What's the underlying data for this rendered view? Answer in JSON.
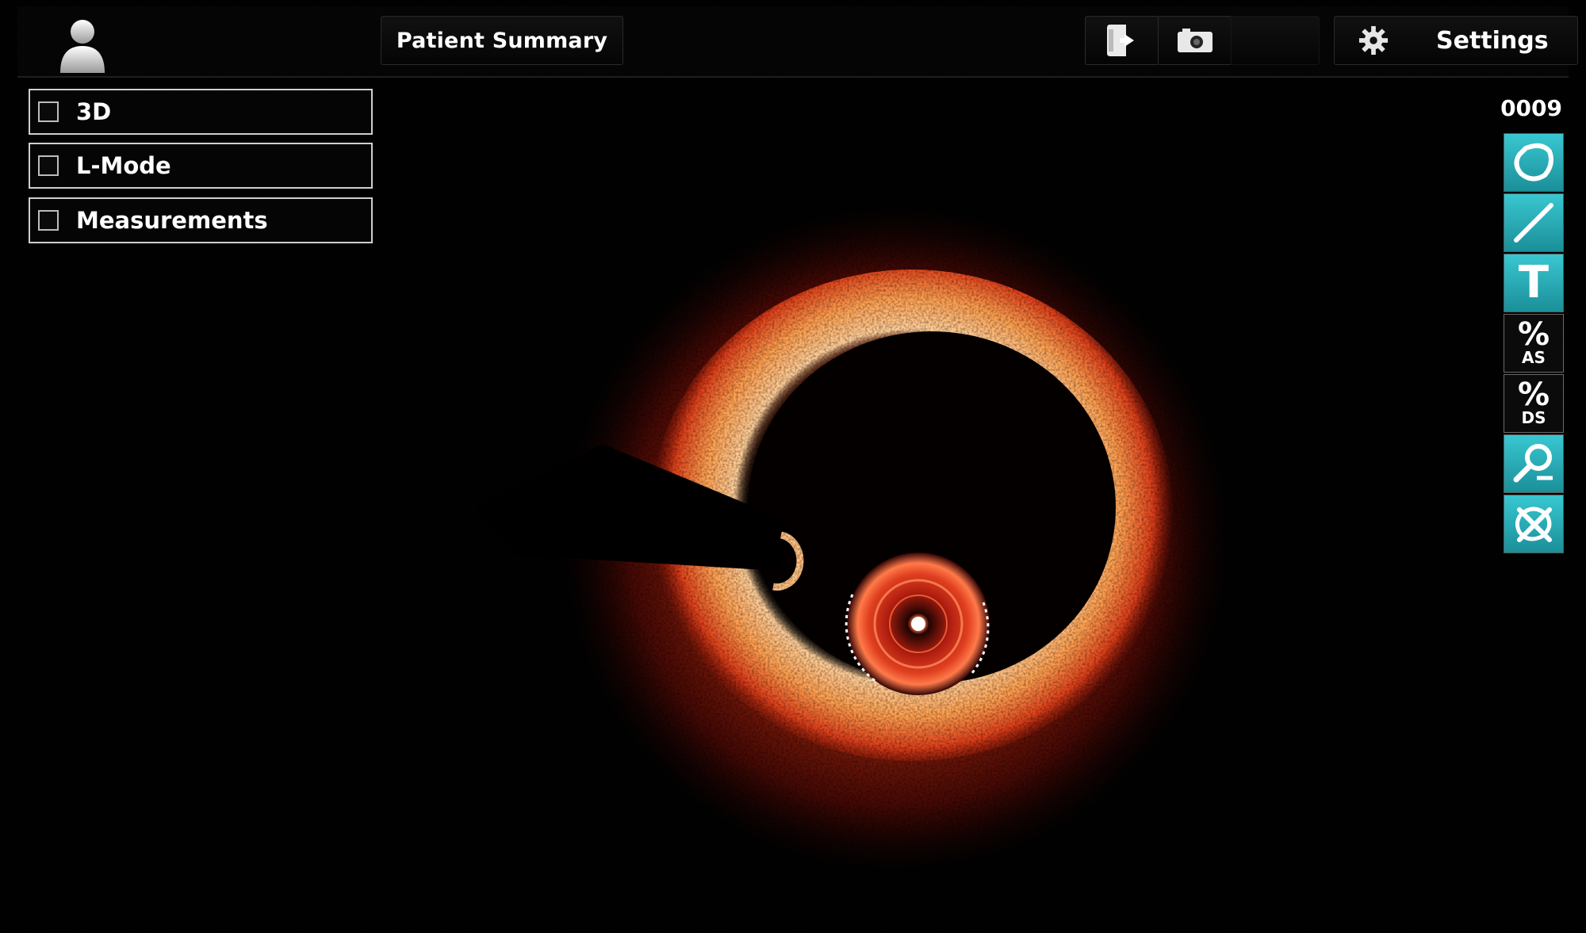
{
  "header": {
    "patient_summary_label": "Patient Summary",
    "settings_label": "Settings",
    "icons": {
      "patient": "patient-icon",
      "export": "export-icon",
      "camera": "camera-icon",
      "settings": "gear-icon"
    }
  },
  "options": [
    {
      "label": "3D",
      "checked": false
    },
    {
      "label": "L-Mode",
      "checked": false
    },
    {
      "label": "Measurements",
      "checked": false
    }
  ],
  "frame_counter": "0009",
  "toolbar": {
    "tools": [
      {
        "name": "freehand-area-icon"
      },
      {
        "name": "line-measure-icon"
      },
      {
        "name": "text-annotation-icon",
        "glyph": "T"
      },
      {
        "name": "percent-area-stenosis",
        "glyph": "%",
        "sub": "AS"
      },
      {
        "name": "percent-diameter-stenosis",
        "glyph": "%",
        "sub": "DS"
      },
      {
        "name": "zoom-out-icon"
      },
      {
        "name": "clear-annotations-icon"
      }
    ]
  },
  "colors": {
    "accent_cyan": "#2bb7c2",
    "image_red": "#c41e0e",
    "image_orange": "#ff8a3a",
    "background": "#000000"
  }
}
